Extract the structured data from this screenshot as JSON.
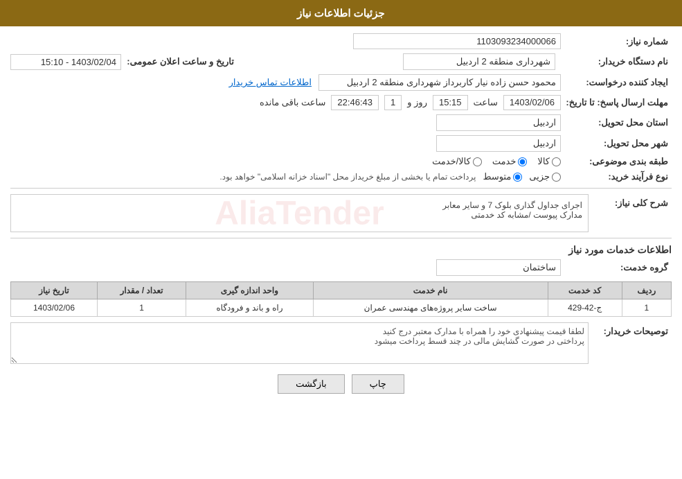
{
  "header": {
    "title": "جزئیات اطلاعات نیاز"
  },
  "fields": {
    "need_number_label": "شماره نیاز:",
    "need_number_value": "1103093234000066",
    "buyer_org_label": "نام دستگاه خریدار:",
    "buyer_org_value": "شهرداری منطقه 2 اردبیل",
    "announce_date_label": "تاریخ و ساعت اعلان عمومی:",
    "announce_date_value": "1403/02/04 - 15:10",
    "creator_label": "ایجاد کننده درخواست:",
    "creator_value": "محمود حسن زاده نیار کاربرداز شهرداری منطقه 2 اردبیل",
    "contact_link": "اطلاعات تماس خریدار",
    "response_deadline_label": "مهلت ارسال پاسخ: تا تاریخ:",
    "response_date_value": "1403/02/06",
    "response_time_label": "ساعت",
    "response_time_value": "15:15",
    "response_day_label": "روز و",
    "response_day_value": "1",
    "remaining_time_value": "22:46:43",
    "remaining_time_label": "ساعت باقی مانده",
    "province_label": "استان محل تحویل:",
    "province_value": "اردبیل",
    "city_label": "شهر محل تحویل:",
    "city_value": "اردبیل",
    "category_label": "طبقه بندی موضوعی:",
    "category_options": [
      "کالا",
      "خدمت",
      "کالا/خدمت"
    ],
    "category_selected": "خدمت",
    "purchase_type_label": "نوع فرآیند خرید:",
    "purchase_type_options": [
      "جزیی",
      "متوسط"
    ],
    "purchase_type_selected": "متوسط",
    "purchase_type_info": "پرداخت تمام یا بخشی از مبلغ خریداز محل \"اسناد خزانه اسلامی\" خواهد بود.",
    "need_description_label": "شرح کلی نیاز:",
    "need_description_line1": "اجرای جداول گذاری بلوک 7 و سایر معابر",
    "need_description_line2": "مدارک پیوست /مشابه کد خدمتی",
    "services_info_title": "اطلاعات خدمات مورد نیاز",
    "service_group_label": "گروه خدمت:",
    "service_group_value": "ساختمان"
  },
  "table": {
    "headers": [
      "ردیف",
      "کد خدمت",
      "نام خدمت",
      "واحد اندازه گیری",
      "تعداد / مقدار",
      "تاریخ نیاز"
    ],
    "rows": [
      {
        "row": "1",
        "code": "ج-42-429",
        "name": "ساخت سایر پروژه‌های مهندسی عمران",
        "unit": "راه و باند و فرودگاه",
        "qty": "1",
        "date": "1403/02/06"
      }
    ]
  },
  "buyer_notes_label": "توصیحات خریدار:",
  "buyer_notes": "لطفا قیمت پیشنهادی خود را همراه با مدارک معتبر درج کنید\nپرداختی در صورت گشایش مالی در چند قسط پرداخت میشود",
  "buttons": {
    "print_label": "چاپ",
    "back_label": "بازگشت"
  }
}
